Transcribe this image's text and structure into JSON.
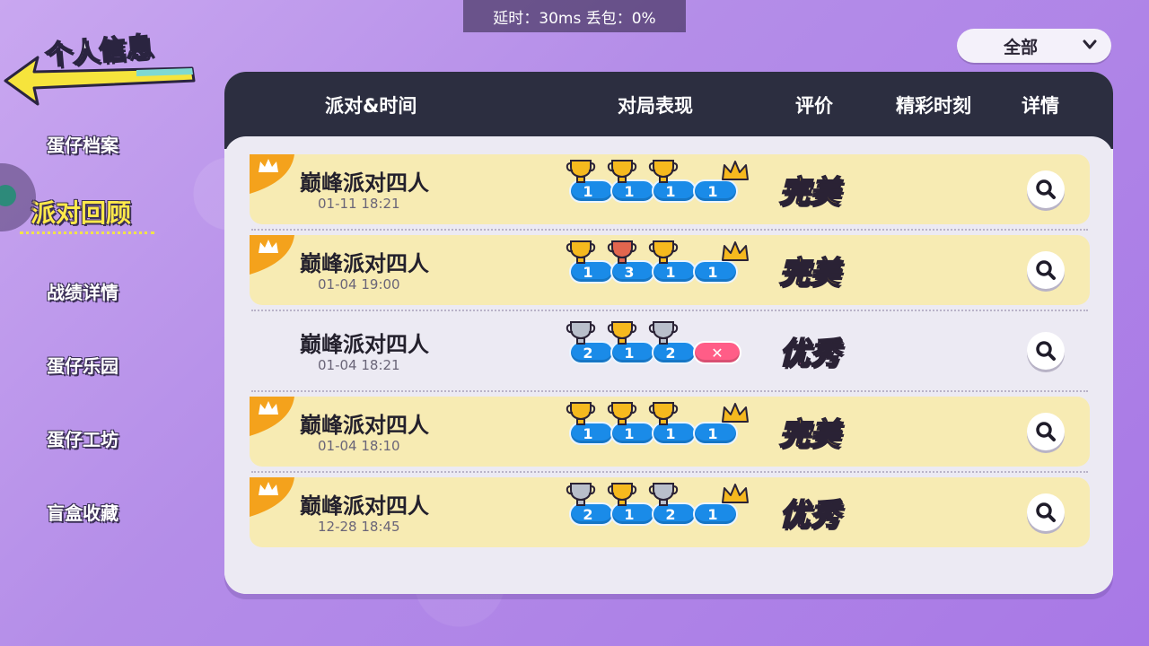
{
  "network": {
    "status_text": "延时：30ms 丢包：0%"
  },
  "header": {
    "title": "个人信息"
  },
  "filter": {
    "selected": "全部"
  },
  "sidebar": {
    "items": [
      {
        "label": "蛋仔档案",
        "active": false
      },
      {
        "label": "派对回顾",
        "active": true
      },
      {
        "label": "战绩详情",
        "active": false
      },
      {
        "label": "蛋仔乐园",
        "active": false
      },
      {
        "label": "蛋仔工坊",
        "active": false
      },
      {
        "label": "盲盒收藏",
        "active": false
      }
    ]
  },
  "table": {
    "columns": [
      "派对&时间",
      "对局表现",
      "评价",
      "精彩时刻",
      "详情"
    ],
    "rows": [
      {
        "mode": "巅峰派对四人",
        "time": "01-11 18:21",
        "highlight": true,
        "crown_tag": true,
        "rounds": [
          {
            "trophy": "gold",
            "rank": "1"
          },
          {
            "trophy": "gold",
            "rank": "1"
          },
          {
            "trophy": "gold",
            "rank": "1"
          },
          {
            "trophy": "crown",
            "rank": "1"
          }
        ],
        "rating": "完美",
        "rating_type": "perfect"
      },
      {
        "mode": "巅峰派对四人",
        "time": "01-04 19:00",
        "highlight": true,
        "crown_tag": true,
        "rounds": [
          {
            "trophy": "gold",
            "rank": "1"
          },
          {
            "trophy": "bronze",
            "rank": "3"
          },
          {
            "trophy": "gold",
            "rank": "1"
          },
          {
            "trophy": "crown",
            "rank": "1"
          }
        ],
        "rating": "完美",
        "rating_type": "perfect"
      },
      {
        "mode": "巅峰派对四人",
        "time": "01-04 18:21",
        "highlight": false,
        "crown_tag": false,
        "rounds": [
          {
            "trophy": "silver",
            "rank": "2"
          },
          {
            "trophy": "gold",
            "rank": "1"
          },
          {
            "trophy": "silver",
            "rank": "2"
          },
          {
            "trophy": "fail",
            "rank": "✕"
          }
        ],
        "rating": "优秀",
        "rating_type": "excellent"
      },
      {
        "mode": "巅峰派对四人",
        "time": "01-04 18:10",
        "highlight": true,
        "crown_tag": true,
        "rounds": [
          {
            "trophy": "gold",
            "rank": "1"
          },
          {
            "trophy": "gold",
            "rank": "1"
          },
          {
            "trophy": "gold",
            "rank": "1"
          },
          {
            "trophy": "crown",
            "rank": "1"
          }
        ],
        "rating": "完美",
        "rating_type": "perfect"
      },
      {
        "mode": "巅峰派对四人",
        "time": "12-28 18:45",
        "highlight": true,
        "crown_tag": true,
        "rounds": [
          {
            "trophy": "silver",
            "rank": "2"
          },
          {
            "trophy": "gold",
            "rank": "1"
          },
          {
            "trophy": "silver",
            "rank": "2"
          },
          {
            "trophy": "crown",
            "rank": "1"
          }
        ],
        "rating": "优秀",
        "rating_type": "excellent"
      }
    ]
  },
  "colors": {
    "gold": "#f6b91e",
    "silver": "#b9bfcb",
    "bronze": "#e2664e",
    "rank_blue": "#1a8be8",
    "fail_pink": "#ff5d87",
    "perfect": "#ffd23a",
    "excellent": "#ff7cbf"
  }
}
